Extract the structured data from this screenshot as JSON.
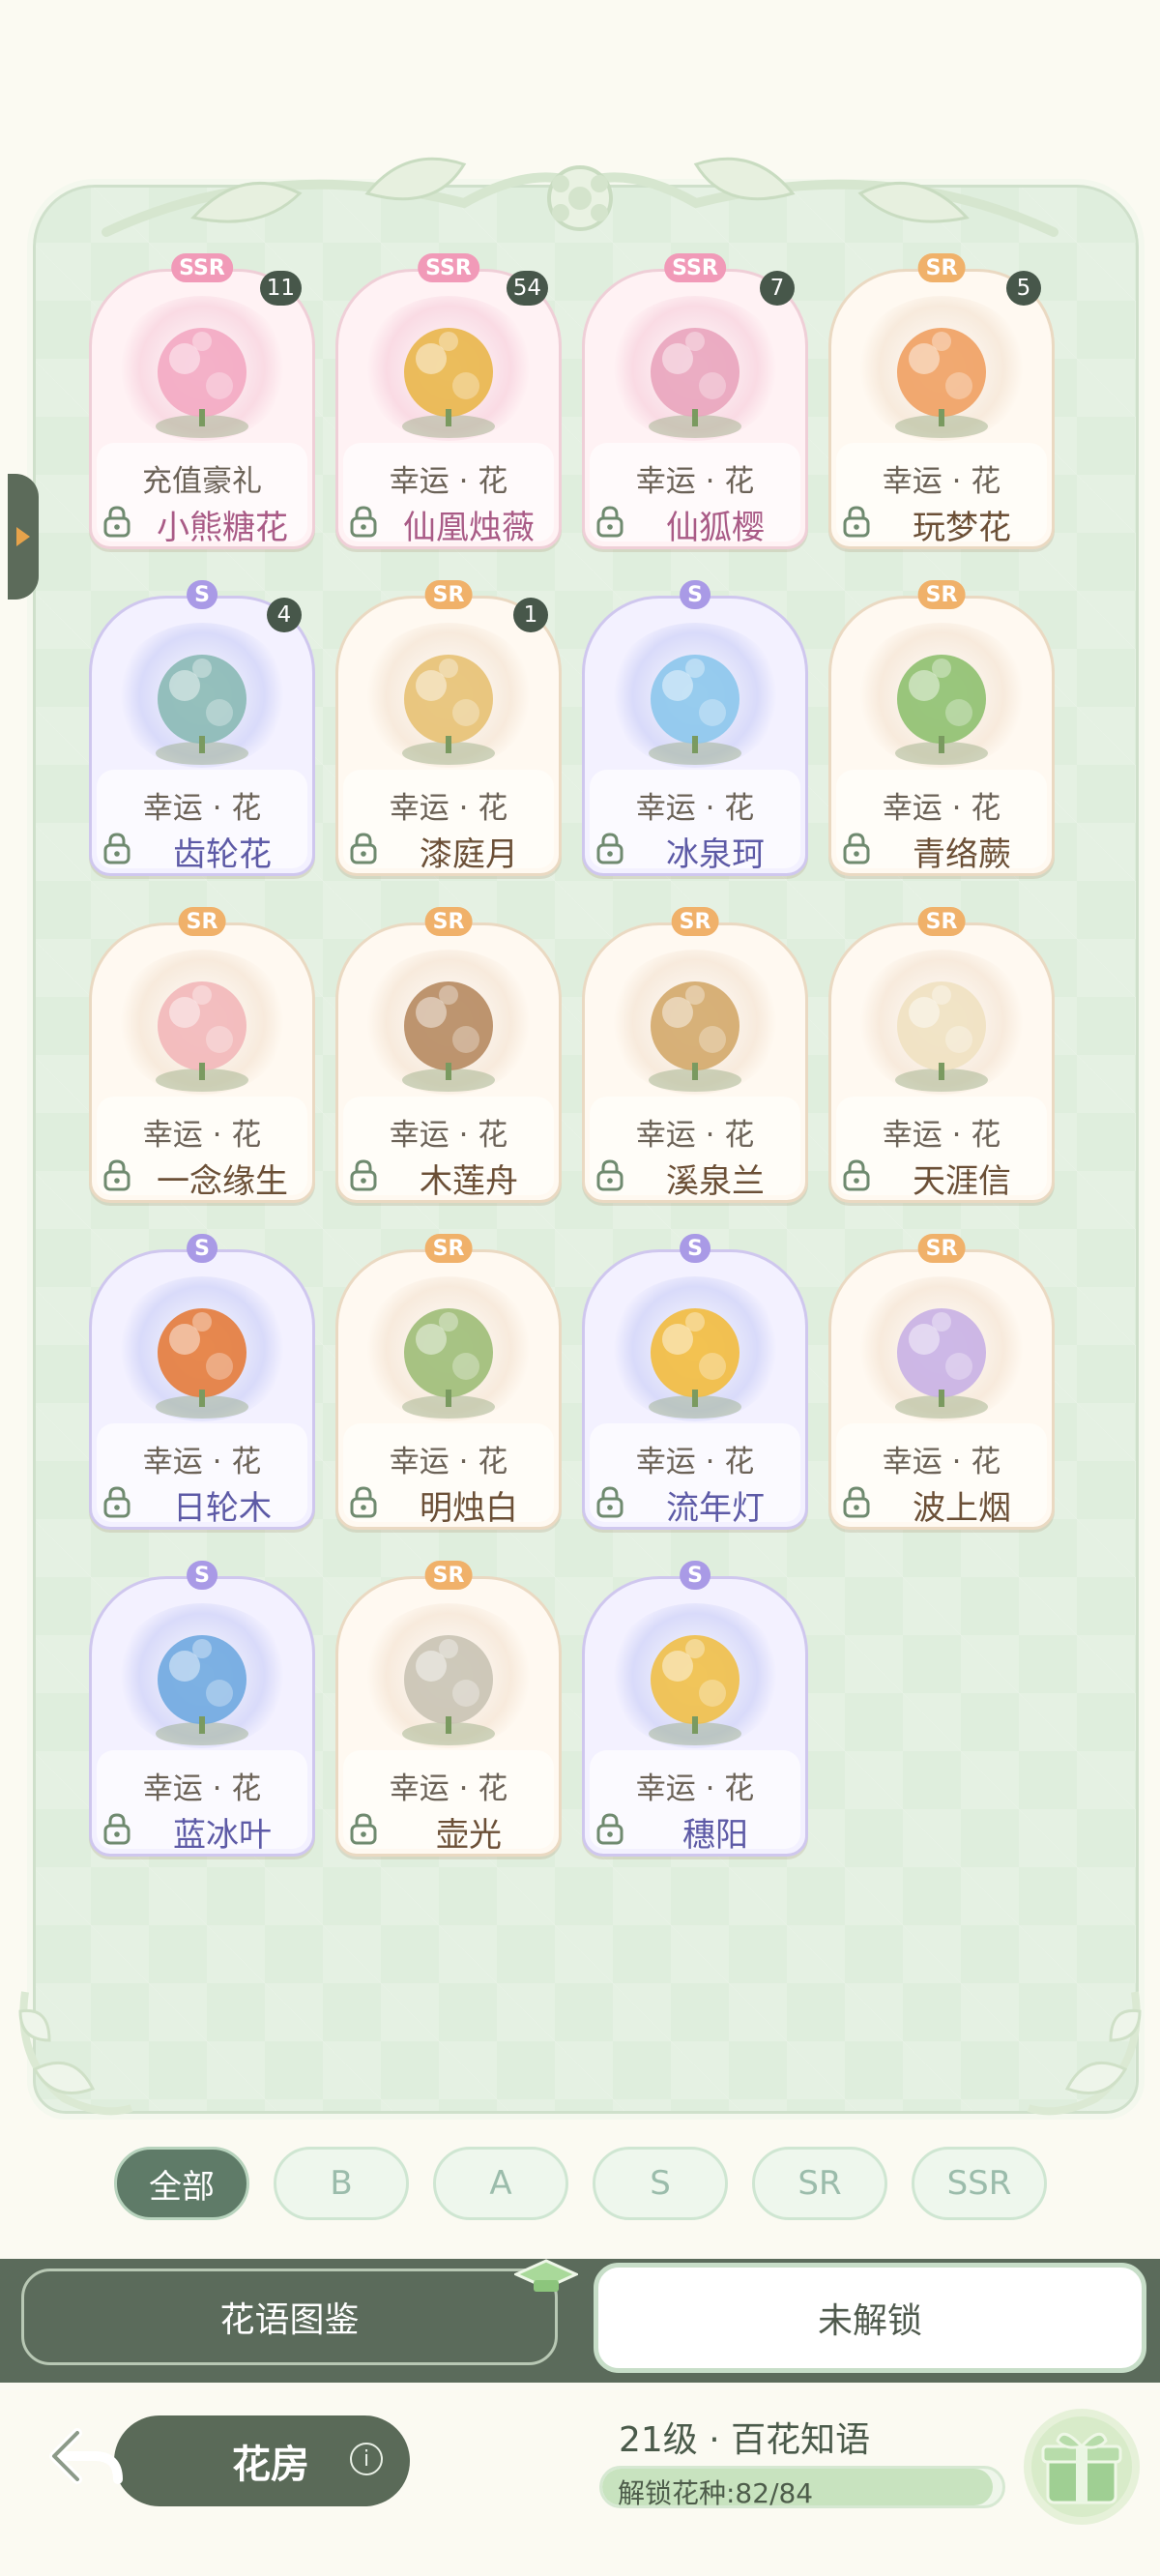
{
  "cards": [
    {
      "rarity": "SSR",
      "count": "11",
      "sub": "充值豪礼",
      "name": "小熊糖花",
      "art": "bear-candy-icon",
      "color": "#f3a9c2"
    },
    {
      "rarity": "SSR",
      "count": "54",
      "sub": "幸运 · 花",
      "name": "仙凰烛薇",
      "art": "phoenix-candle-icon",
      "color": "#e9b64a"
    },
    {
      "rarity": "SSR",
      "count": "7",
      "sub": "幸运 · 花",
      "name": "仙狐樱",
      "art": "fox-sakura-icon",
      "color": "#e9a4bd"
    },
    {
      "rarity": "SR",
      "count": "5",
      "sub": "幸运 · 花",
      "name": "玩梦花",
      "art": "dream-castle-icon",
      "color": "#f0a062"
    },
    {
      "rarity": "S",
      "count": "4",
      "sub": "幸运 · 花",
      "name": "齿轮花",
      "art": "gear-flower-icon",
      "color": "#8ab9b5"
    },
    {
      "rarity": "SR",
      "count": "1",
      "sub": "幸运 · 花",
      "name": "漆庭月",
      "art": "moon-pavilion-icon",
      "color": "#e7c173"
    },
    {
      "rarity": "S",
      "count": "",
      "sub": "幸运 · 花",
      "name": "冰泉珂",
      "art": "ice-spring-icon",
      "color": "#8cc6ec"
    },
    {
      "rarity": "SR",
      "count": "",
      "sub": "幸运 · 花",
      "name": "青络蕨",
      "art": "fern-heart-icon",
      "color": "#8ec06f"
    },
    {
      "rarity": "SR",
      "count": "",
      "sub": "幸运 · 花",
      "name": "一念缘生",
      "art": "heart-frame-icon",
      "color": "#f2b7b9"
    },
    {
      "rarity": "SR",
      "count": "",
      "sub": "幸运 · 花",
      "name": "木莲舟",
      "art": "lotus-boat-icon",
      "color": "#b68a61"
    },
    {
      "rarity": "SR",
      "count": "",
      "sub": "幸运 · 花",
      "name": "溪泉兰",
      "art": "stream-orchid-icon",
      "color": "#d3a86a"
    },
    {
      "rarity": "SR",
      "count": "",
      "sub": "幸运 · 花",
      "name": "天涯信",
      "art": "cloud-letter-icon",
      "color": "#f0e1c1"
    },
    {
      "rarity": "S",
      "count": "",
      "sub": "幸运 · 花",
      "name": "日轮木",
      "art": "sun-tree-icon",
      "color": "#e47b3b"
    },
    {
      "rarity": "SR",
      "count": "",
      "sub": "幸运 · 花",
      "name": "明烛白",
      "art": "white-lily-icon",
      "color": "#9dbd77"
    },
    {
      "rarity": "S",
      "count": "",
      "sub": "幸运 · 花",
      "name": "流年灯",
      "art": "lantern-tree-icon",
      "color": "#f2bb3e"
    },
    {
      "rarity": "SR",
      "count": "",
      "sub": "幸运 · 花",
      "name": "波上烟",
      "art": "purple-orb-icon",
      "color": "#c8b0e4"
    },
    {
      "rarity": "S",
      "count": "",
      "sub": "幸运 · 花",
      "name": "蓝冰叶",
      "art": "blue-ice-leaf-icon",
      "color": "#6fa9e0"
    },
    {
      "rarity": "SR",
      "count": "",
      "sub": "幸运 · 花",
      "name": "壶光",
      "art": "teapot-icon",
      "color": "#c9c3b4"
    },
    {
      "rarity": "S",
      "count": "",
      "sub": "幸运 · 花",
      "name": "穗阳",
      "art": "golden-bloom-icon",
      "color": "#f0bf48"
    }
  ],
  "filters": [
    "全部",
    "B",
    "A",
    "S",
    "SR",
    "SSR"
  ],
  "filter_active_index": 0,
  "tabs": {
    "left": "花语图鉴",
    "right": "未解锁"
  },
  "footer": {
    "room_label": "花房",
    "info_glyph": "i",
    "level": "21级 · 百花知语",
    "progress_text": "解锁花种:82/84",
    "progress_fraction": 0.976
  },
  "colors": {
    "panel": "#dfeedd",
    "accent": "#5b6b5b",
    "tab_active": "#ffffff"
  }
}
